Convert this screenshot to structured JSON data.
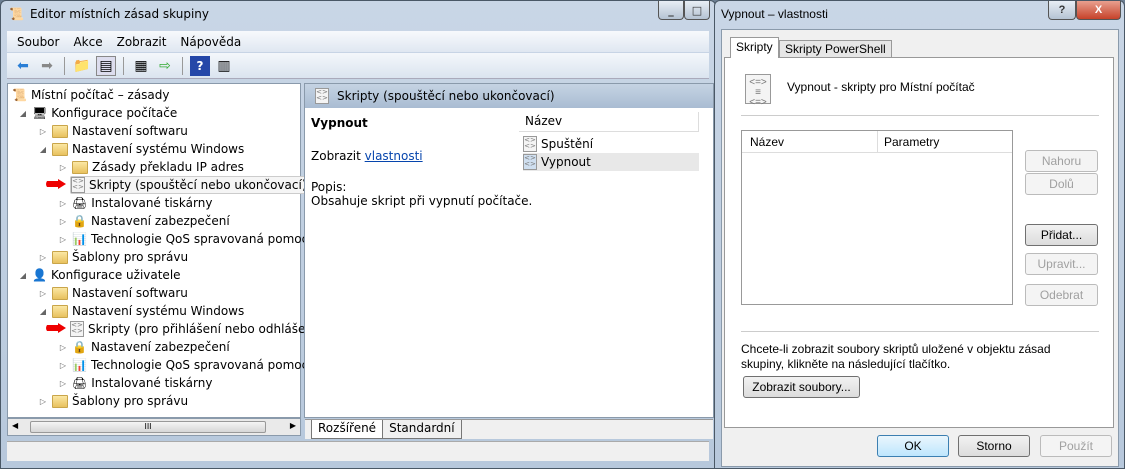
{
  "main_window": {
    "title": "Editor místních zásad skupiny",
    "menu": [
      "Soubor",
      "Akce",
      "Zobrazit",
      "Nápověda"
    ],
    "tree": {
      "root": "Místní počítač – zásady",
      "computer": "Konfigurace počítače",
      "user": "Konfigurace uživatele",
      "items": [
        "Nastavení softwaru",
        "Nastavení systému Windows",
        "Zásady překladu IP adres",
        "Skripty (spouštěcí nebo ukončovací)",
        "Instalované tiskárny",
        "Nastavení zabezpečení",
        "Technologie QoS spravovaná pomocí z",
        "Šablony pro správu",
        "Nastavení softwaru",
        "Nastavení systému Windows",
        "Skripty (pro přihlášení nebo odhlášení)",
        "Nastavení zabezpečení",
        "Technologie QoS spravovaná pomocí z",
        "Instalované tiskárny",
        "Šablony pro správu"
      ],
      "scroll_grip": "III"
    },
    "details": {
      "header": "Skripty (spouštěcí nebo ukončovací)",
      "selected_name": "Vypnout",
      "show_prefix": "Zobrazit",
      "show_link": "vlastnosti",
      "desc_label": "Popis:",
      "desc_text": "Obsahuje skript při vypnutí počítače.",
      "column_name": "Název",
      "list": [
        "Spuštění",
        "Vypnout"
      ],
      "tabs": [
        "Rozšířené",
        "Standardní"
      ]
    }
  },
  "dialog": {
    "title": "Vypnout – vlastnosti",
    "help": "?",
    "close": "X",
    "tabs": [
      "Skripty",
      "Skripty PowerShell"
    ],
    "heading": "Vypnout - skripty pro Místní počítač",
    "columns": [
      "Název",
      "Parametry"
    ],
    "side_buttons": [
      "Nahoru",
      "Dolů",
      "Přidat...",
      "Upravit...",
      "Odebrat"
    ],
    "info": "Chcete-li zobrazit soubory skriptů uložené v objektu zásad skupiny, klikněte na následující tlačítko.",
    "show_files": "Zobrazit soubory...",
    "ok": "OK",
    "cancel": "Storno",
    "apply": "Použít"
  }
}
